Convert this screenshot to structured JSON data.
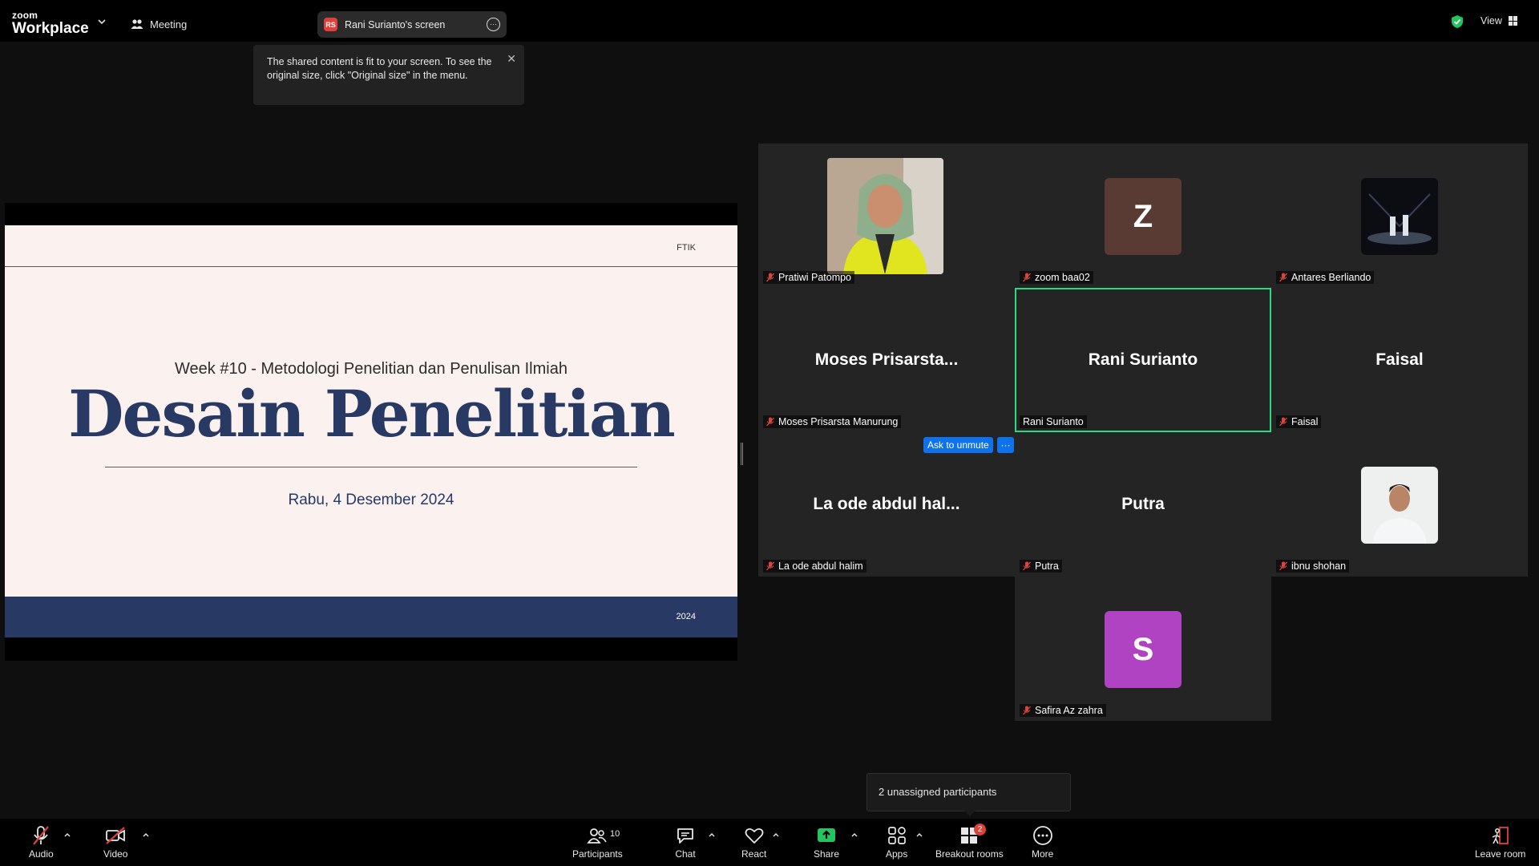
{
  "app": {
    "brand_top": "zoom",
    "brand_bottom": "Workplace",
    "meeting_label": "Meeting",
    "share_badge": "RS",
    "share_label": "Rani Surianto's screen",
    "view_label": "View",
    "colors": {
      "active_speaker": "#2bd980",
      "accent_blue": "#0e72ed",
      "muted_red": "#e0403a",
      "share_green": "#22c55e"
    }
  },
  "tooltip": {
    "text": "The shared content is fit to your screen. To see the original size, click \"Original size\" in the menu.",
    "close_icon": "close-icon"
  },
  "slide": {
    "tag": "FTIK",
    "week": "Week #10 - Metodologi Penelitian dan Penulisan Ilmiah",
    "title": "Desain Penelitian",
    "date": "Rabu, 4 Desember 2024",
    "year": "2024"
  },
  "gallery": {
    "ask_unmute": "Ask to unmute",
    "ask_more": "···",
    "tiles": [
      {
        "label": "Pratiwi Patompo",
        "kind": "photo",
        "muted": true
      },
      {
        "label": "zoom baa02",
        "kind": "letter",
        "letter": "Z",
        "avatar_color": "#5a3b33",
        "muted": true
      },
      {
        "label": "Antares Berliando",
        "kind": "photo",
        "muted": true
      },
      {
        "label": "Moses Prisarsta Manurung",
        "center": "Moses Prisarsta...",
        "muted": true
      },
      {
        "label": "Rani Surianto",
        "center": "Rani Surianto",
        "muted": false,
        "active": true
      },
      {
        "label": "Faisal",
        "center": "Faisal",
        "muted": true
      },
      {
        "label": "La ode abdul halim",
        "center": "La ode abdul hal...",
        "muted": true
      },
      {
        "label": "Putra",
        "center": "Putra",
        "muted": true
      },
      {
        "label": "ibnu shohan",
        "kind": "photo",
        "muted": true
      },
      {
        "label": "Safira Az zahra",
        "kind": "letter",
        "letter": "S",
        "avatar_color": "#b043c2",
        "muted": true
      }
    ]
  },
  "unassigned": {
    "text": "2 unassigned participants"
  },
  "toolbar": {
    "audio": "Audio",
    "video": "Video",
    "participants": "Participants",
    "participants_count": "10",
    "chat": "Chat",
    "react": "React",
    "share": "Share",
    "apps": "Apps",
    "breakout": "Breakout rooms",
    "breakout_badge": "2",
    "more": "More",
    "leave": "Leave room"
  }
}
